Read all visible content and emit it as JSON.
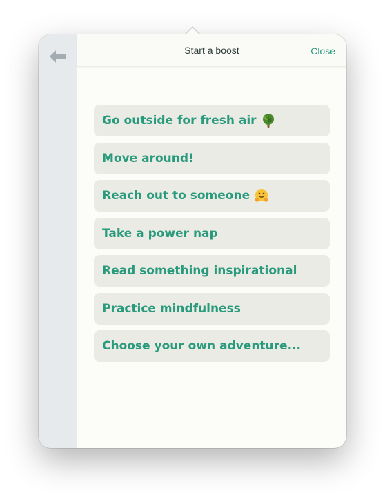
{
  "header": {
    "title": "Start a boost",
    "close_label": "Close"
  },
  "sidebar": {
    "back_icon": "arrow-left-icon"
  },
  "boosts": [
    {
      "label": "Go outside for fresh air",
      "icon": "tree-icon"
    },
    {
      "label": "Move around!",
      "icon": null
    },
    {
      "label": "Reach out to someone",
      "icon": "hugging-face-icon"
    },
    {
      "label": "Take a power nap",
      "icon": null
    },
    {
      "label": "Read something inspirational",
      "icon": null
    },
    {
      "label": "Practice mindfulness",
      "icon": null
    },
    {
      "label": "Choose your own adventure...",
      "icon": null
    }
  ],
  "colors": {
    "accent": "#2a9a7c",
    "sidebar": "#e6eaec",
    "item_bg": "#ebebe6",
    "panel_bg": "#fcfcf8"
  }
}
